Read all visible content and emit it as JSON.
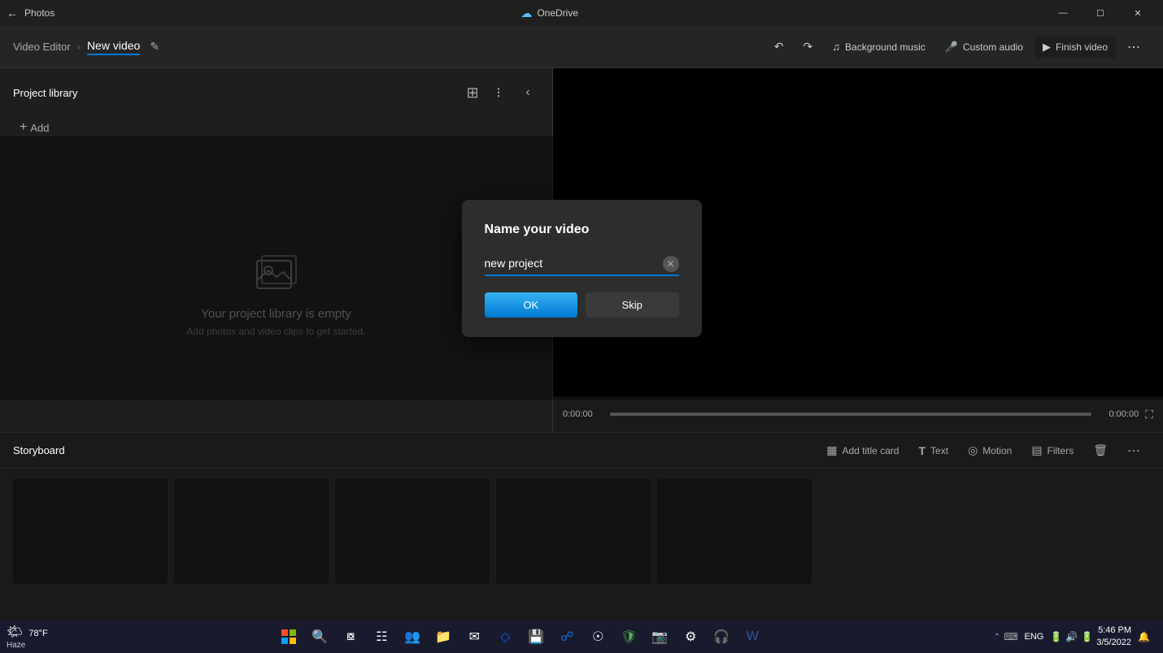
{
  "app": {
    "title": "Photos",
    "onedrive": "OneDrive"
  },
  "toolbar": {
    "breadcrumb_label": "Video Editor",
    "separator": "›",
    "video_title": "New video",
    "undo_label": "Undo",
    "redo_label": "Redo",
    "bg_music_label": "Background music",
    "custom_audio_label": "Custom audio",
    "finish_video_label": "Finish video",
    "more_label": "More"
  },
  "project_library": {
    "title": "Project library",
    "add_label": "Add",
    "collapse_label": "Collapse",
    "empty_title": "Your project library is empty",
    "empty_sub": "Add photos and video clips to get started."
  },
  "video_controls": {
    "time_start": "0:00:00",
    "time_end": "0:00:00"
  },
  "storyboard": {
    "title": "Storyboard",
    "add_title_card_label": "Add title card",
    "text_label": "Text",
    "motion_label": "Motion",
    "filters_label": "Filters",
    "delete_label": "Delete",
    "more_label": "More"
  },
  "modal": {
    "title": "Name your video",
    "input_value": "new project",
    "ok_label": "OK",
    "skip_label": "Skip"
  },
  "taskbar": {
    "weather_temp": "78°F",
    "weather_desc": "Haze",
    "time": "5:46 PM",
    "date": "3/5/2022",
    "lang": "ENG"
  }
}
